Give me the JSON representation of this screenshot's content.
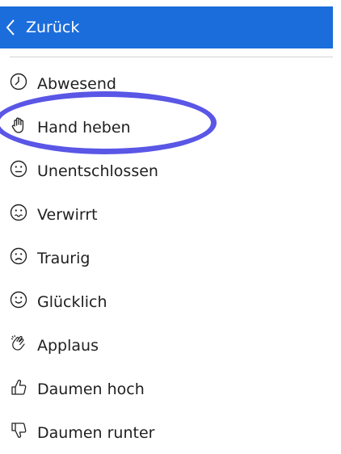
{
  "header": {
    "back_label": "Zurück"
  },
  "menu": {
    "items": [
      {
        "label": "Abwesend",
        "icon": "clock-icon"
      },
      {
        "label": "Hand heben",
        "icon": "raised-hand-icon"
      },
      {
        "label": "Unentschlossen",
        "icon": "neutral-face-icon"
      },
      {
        "label": "Verwirrt",
        "icon": "confused-face-icon"
      },
      {
        "label": "Traurig",
        "icon": "sad-face-icon"
      },
      {
        "label": "Glücklich",
        "icon": "happy-face-icon"
      },
      {
        "label": "Applaus",
        "icon": "clapping-hands-icon"
      },
      {
        "label": "Daumen hoch",
        "icon": "thumbs-up-icon"
      },
      {
        "label": "Daumen runter",
        "icon": "thumbs-down-icon"
      }
    ]
  },
  "colors": {
    "header_bg": "#1b6ddb",
    "highlight": "#5a56e6"
  }
}
